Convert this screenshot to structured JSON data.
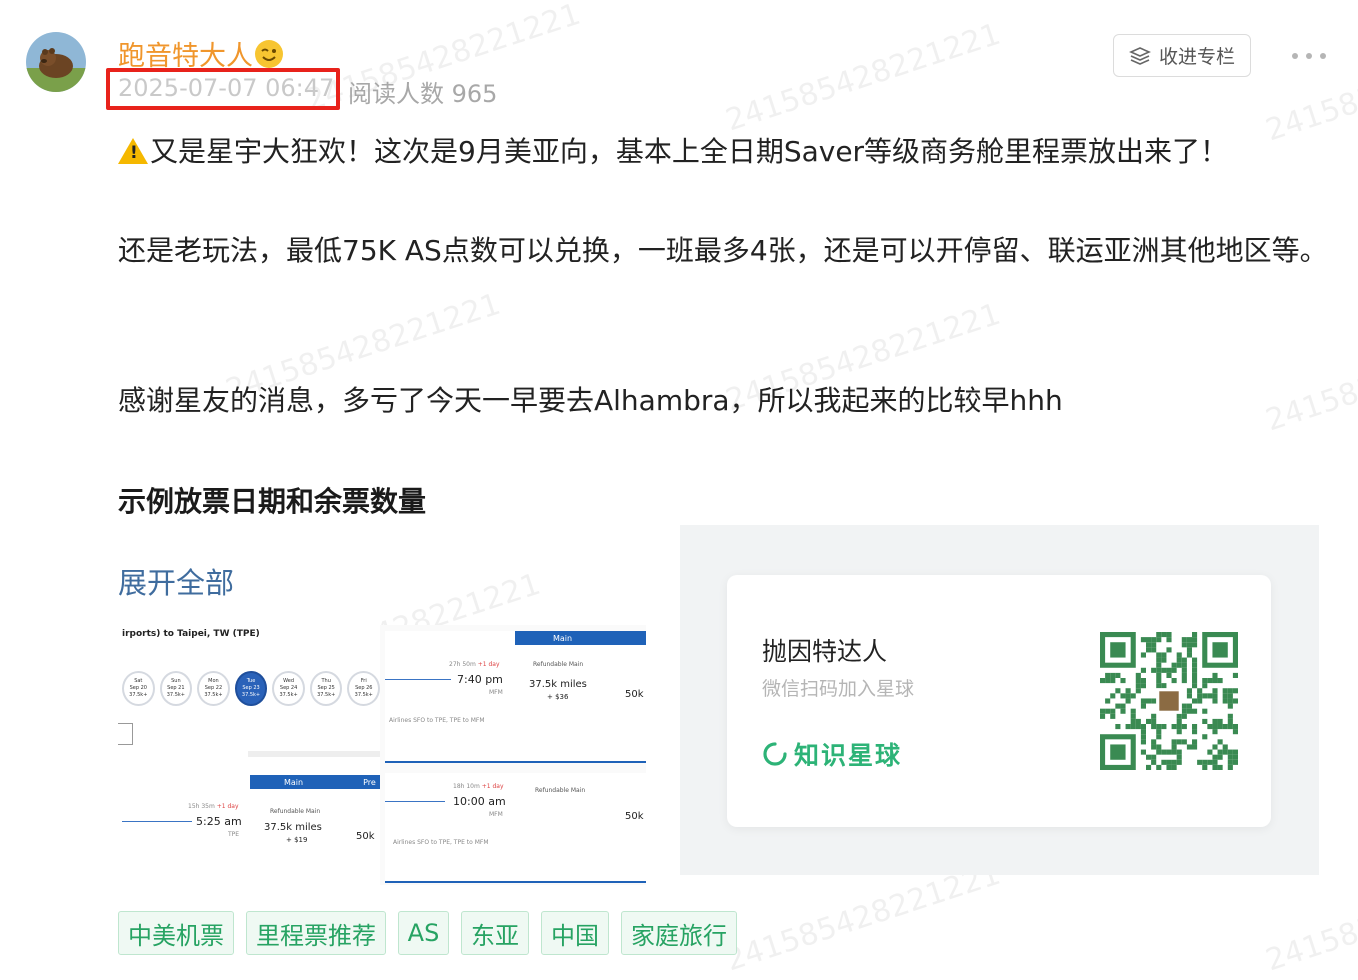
{
  "post": {
    "author": "跑音特大人",
    "date": "2025-07-07 06:47",
    "reads": "阅读人数 965",
    "collect_label": "收进专栏",
    "paragraphs": [
      "又是星宇大狂欢！这次是9月美亚向，基本上全日期Saver等级商务舱里程票放出来了！",
      "还是老玩法，最低75K AS点数可以兑换，一班最多4张，还是可以开停留、联运亚洲其他地区等。",
      "感谢星友的消息，多亏了今天一早要去Alhambra，所以我起来的比较早hhh"
    ],
    "heading": "示例放票日期和余票数量",
    "expand_label": "展开全部"
  },
  "screenshot": {
    "route": "irports) to Taipei, TW (TPE)",
    "days": [
      {
        "d": "Sat",
        "date": "Sep 20",
        "p": "37.5k+"
      },
      {
        "d": "Sun",
        "date": "Sep 21",
        "p": "37.5k+"
      },
      {
        "d": "Mon",
        "date": "Sep 22",
        "p": "37.5k+"
      },
      {
        "d": "Tue",
        "date": "Sep 23",
        "p": "37.5k+"
      },
      {
        "d": "Wed",
        "date": "Sep 24",
        "p": "37.5k+"
      },
      {
        "d": "Thu",
        "date": "Sep 25",
        "p": "37.5k+"
      },
      {
        "d": "Fri",
        "date": "Sep 26",
        "p": "37.5k+"
      }
    ],
    "main_label": "Main",
    "pre_label": "Pre",
    "f1": {
      "dur": "27h 50m",
      "plus": "+1 day",
      "time": "7:40 pm",
      "code": "MFM",
      "fare_title": "Refundable Main",
      "miles": "37.5k miles",
      "tax": "+ $36",
      "right": "50k",
      "route": "Airlines SFO to TPE, TPE to MFM"
    },
    "f2": {
      "dur": "18h 10m",
      "plus": "+1 day",
      "time": "10:00 am",
      "code": "MFM",
      "fare_title": "Refundable Main",
      "right": "50k",
      "route": "Airlines SFO to TPE, TPE to MFM"
    },
    "f3": {
      "dur": "15h 35m",
      "plus": "+1 day",
      "time": "5:25 am",
      "code": "TPE",
      "fare_title": "Refundable Main",
      "miles": "37.5k miles",
      "tax": "+ $19",
      "right": "50k"
    }
  },
  "card": {
    "title": "抛因特达人",
    "subtitle": "微信扫码加入星球",
    "brand": "知识星球"
  },
  "tags": [
    "中美机票",
    "里程票推荐",
    "AS",
    "东亚",
    "中国",
    "家庭旅行"
  ],
  "watermark": "2415854282212​21",
  "colors": {
    "author": "#f0962c",
    "tag": "#27a363",
    "brand": "#2db377",
    "link": "#3f6c9e",
    "highlight": "#e8221b"
  }
}
